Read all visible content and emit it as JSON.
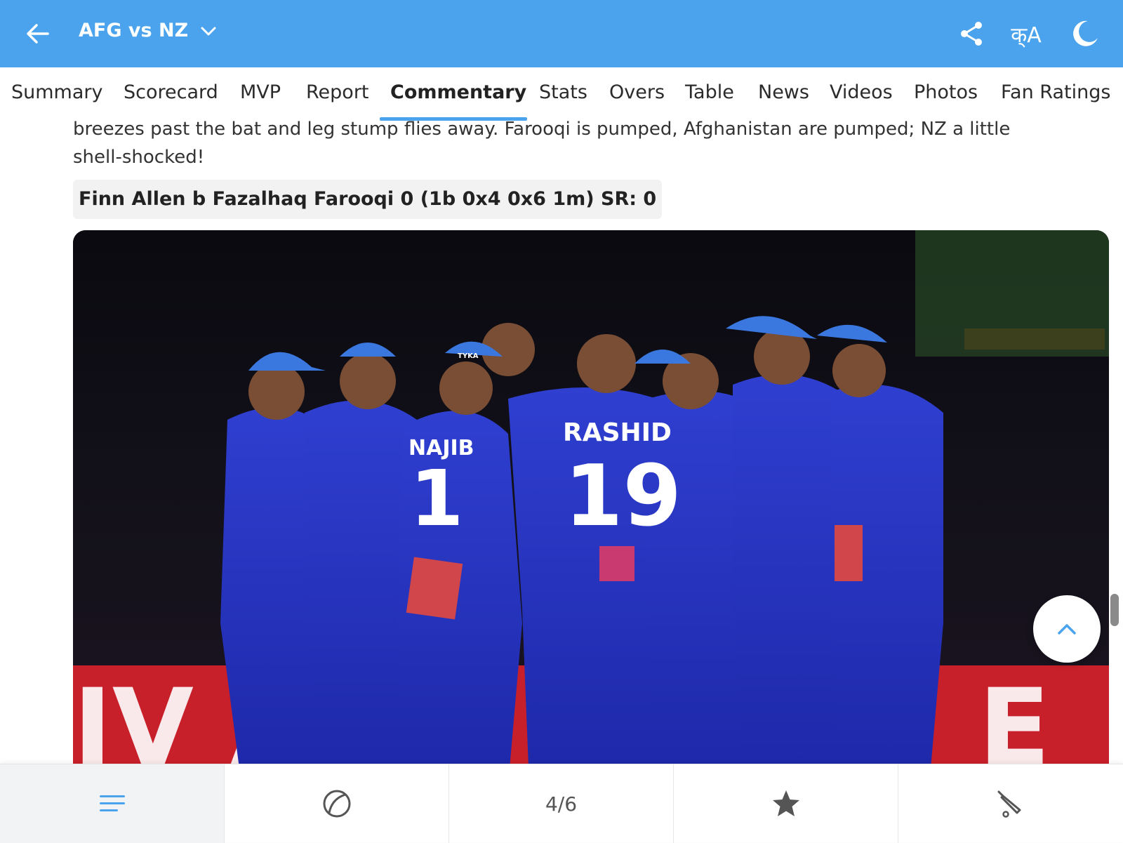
{
  "header": {
    "title": "AFG vs NZ",
    "lang_label": "क्A",
    "colors": {
      "bar": "#4aa3ec",
      "text": "#ffffff"
    },
    "icons": [
      "back-arrow-icon",
      "chevron-down-icon",
      "share-icon",
      "language-icon",
      "moon-icon"
    ]
  },
  "tabs": [
    {
      "label": "Summary"
    },
    {
      "label": "Scorecard"
    },
    {
      "label": "MVP"
    },
    {
      "label": "Report"
    },
    {
      "label": "Commentary",
      "active": true
    },
    {
      "label": "Stats"
    },
    {
      "label": "Overs"
    },
    {
      "label": "Table"
    },
    {
      "label": "News"
    },
    {
      "label": "Videos"
    },
    {
      "label": "Photos"
    },
    {
      "label": "Fan Ratings"
    }
  ],
  "commentary": {
    "text": "breezes past the bat and leg stump flies away. Farooqi is pumped, Afghanistan are pumped; NZ a little shell-shocked!",
    "dismissal": "Finn Allen b Fazalhaq Farooqi 0 (1b 0x4 0x6 1m) SR: 0",
    "photo": {
      "jerseys": [
        "NAJIB",
        "1",
        "RASHID",
        "19"
      ],
      "cap_text": "TYKA"
    }
  },
  "bottom_bar": {
    "page_indicator": "4/6",
    "icons": [
      "menu-icon",
      "ball-icon",
      "star-icon",
      "bat-icon"
    ]
  }
}
